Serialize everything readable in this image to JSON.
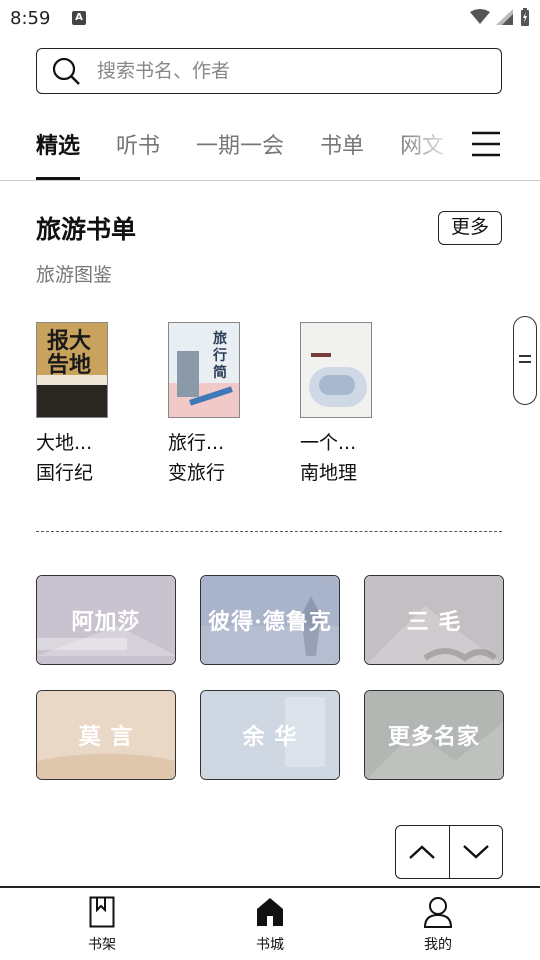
{
  "status_bar": {
    "time": "8:59",
    "notification_icon": "A"
  },
  "search": {
    "placeholder": "搜索书名、作者"
  },
  "tabs": [
    {
      "label": "精选",
      "active": true
    },
    {
      "label": "听书",
      "active": false
    },
    {
      "label": "一期一会",
      "active": false
    },
    {
      "label": "书单",
      "active": false
    },
    {
      "label": "网文",
      "active": false
    }
  ],
  "section": {
    "title": "旅游书单",
    "more_label": "更多",
    "subtitle": "旅游图鉴"
  },
  "books": [
    {
      "line1": "大地...",
      "line2": "国行纪"
    },
    {
      "line1": "旅行...",
      "line2": "变旅行"
    },
    {
      "line1": "一个...",
      "line2": "南地理"
    }
  ],
  "authors": [
    {
      "name": "阿加莎",
      "color": "#c9c3cf"
    },
    {
      "name": "彼得·德鲁克",
      "color": "#a9b3c9"
    },
    {
      "name": "三 毛",
      "color": "#c4bfc3"
    },
    {
      "name": "莫 言",
      "color": "#ead8c6"
    },
    {
      "name": "余 华",
      "color": "#cfd8e2"
    },
    {
      "name": "更多名家",
      "color": "#b3b7b3"
    }
  ],
  "bottom_nav": [
    {
      "label": "书架",
      "icon": "bookshelf-icon"
    },
    {
      "label": "书城",
      "icon": "home-icon"
    },
    {
      "label": "我的",
      "icon": "person-icon"
    }
  ]
}
